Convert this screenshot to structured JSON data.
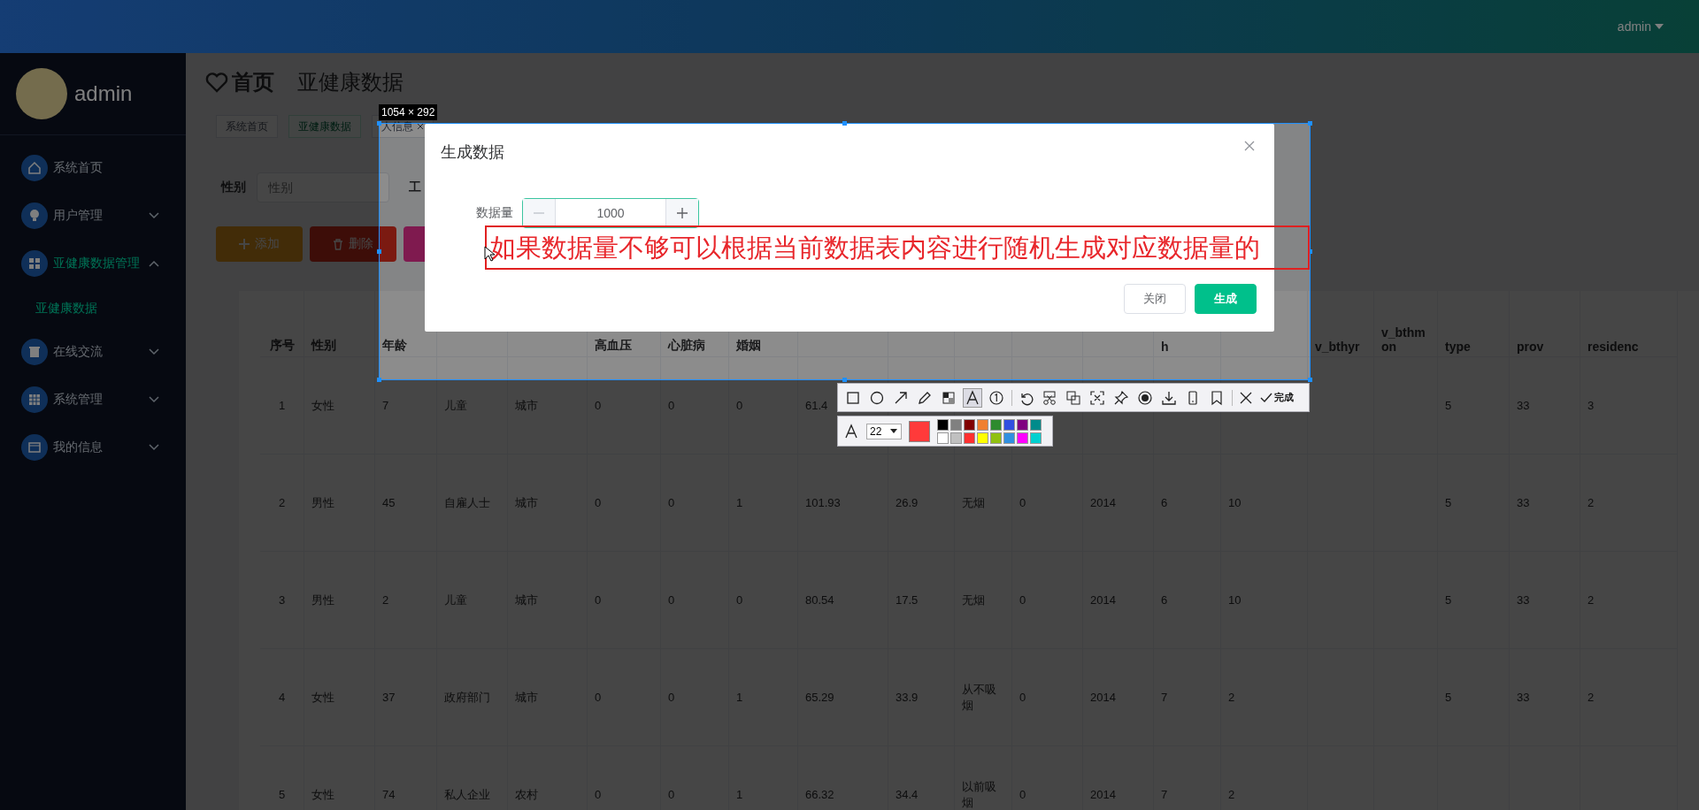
{
  "header": {
    "user": "admin"
  },
  "sidebar": {
    "profile_name": "admin",
    "items": [
      {
        "label": "系统首页",
        "kind": "link",
        "selected": false
      },
      {
        "label": "用户管理",
        "kind": "group",
        "selected": false,
        "expanded": false
      },
      {
        "label": "亚健康数据管理",
        "kind": "group",
        "selected": true,
        "expanded": true,
        "children": [
          {
            "label": "亚健康数据",
            "selected": true
          }
        ]
      },
      {
        "label": "在线交流",
        "kind": "group",
        "selected": false,
        "expanded": false
      },
      {
        "label": "系统管理",
        "kind": "group",
        "selected": false,
        "expanded": false
      },
      {
        "label": "我的信息",
        "kind": "group",
        "selected": false,
        "expanded": false
      }
    ]
  },
  "page_title": {
    "home": "首页",
    "current": "亚健康数据"
  },
  "tags": [
    {
      "label": "系统首页",
      "selected": false,
      "closable": false
    },
    {
      "label": "亚健康数据",
      "selected": true,
      "closable": false
    },
    {
      "label": "人信息",
      "selected": false,
      "closable": true
    }
  ],
  "filters": [
    {
      "label": "性别",
      "placeholder": "性别"
    },
    {
      "label": "工"
    }
  ],
  "actions": [
    {
      "label": "添加",
      "kind": "add"
    },
    {
      "label": "删除",
      "kind": "delete"
    },
    {
      "kind": "plain"
    }
  ],
  "table": {
    "columns": [
      "序号",
      "性别",
      "年龄",
      null,
      null,
      "高血压",
      "心脏病",
      "婚姻",
      null,
      null,
      null,
      null,
      null,
      "h",
      null,
      "v_bthyr",
      "v_bthmon",
      "type",
      "prov",
      "residenc"
    ],
    "rows": [
      [
        "1",
        "女性",
        "7",
        "儿童",
        "城市",
        "0",
        "0",
        "0",
        "61.4",
        null,
        null,
        null,
        null,
        null,
        null,
        null,
        null,
        "5",
        "33",
        "3"
      ],
      [
        "2",
        "男性",
        "45",
        "自雇人士",
        "城市",
        "0",
        "0",
        "1",
        "101.93",
        "26.9",
        "无烟",
        "0",
        "2014",
        "6",
        "10",
        null,
        null,
        "5",
        "33",
        "2"
      ],
      [
        "3",
        "男性",
        "2",
        "儿童",
        "城市",
        "0",
        "0",
        "0",
        "80.54",
        "17.5",
        "无烟",
        "0",
        "2014",
        "6",
        "10",
        null,
        null,
        "5",
        "33",
        "2"
      ],
      [
        "4",
        "女性",
        "37",
        "政府部门",
        "城市",
        "0",
        "0",
        "1",
        "65.29",
        "33.9",
        "从不吸烟",
        "0",
        "2014",
        "7",
        "2",
        null,
        null,
        "5",
        "33",
        "2"
      ],
      [
        "5",
        "女性",
        "74",
        "私人企业",
        "农村",
        "0",
        "0",
        "1",
        "66.32",
        "34.4",
        "以前吸烟",
        "0",
        "2014",
        "7",
        "2",
        null,
        null,
        null,
        null,
        null
      ]
    ]
  },
  "dialog": {
    "title": "生成数据",
    "field": {
      "label": "数据量",
      "value": "1000"
    },
    "buttons": [
      {
        "label": "关闭",
        "kind": "secondary"
      },
      {
        "label": "生成",
        "kind": "primary"
      }
    ]
  },
  "capture": {
    "size_label": "1054 × 292",
    "annotation": "如果数据量不够可以根据当前数据表内容进行随机生成对应数据量的",
    "tool_groups": [
      [
        {
          "kind": "rect",
          "selected": false
        },
        {
          "kind": "ellipse",
          "selected": false
        },
        {
          "kind": "arrow",
          "selected": false
        },
        {
          "kind": "pen",
          "selected": false
        },
        {
          "kind": "mosaic",
          "selected": false
        },
        {
          "kind": "text",
          "selected": true
        },
        {
          "kind": "number",
          "selected": false
        }
      ],
      [
        {
          "kind": "undo",
          "selected": false
        },
        {
          "kind": "cut",
          "selected": false
        },
        {
          "kind": "copy",
          "selected": false
        },
        {
          "kind": "scan",
          "selected": false
        },
        {
          "kind": "pin",
          "selected": false
        },
        {
          "kind": "record",
          "selected": false
        },
        {
          "kind": "download",
          "selected": false
        },
        {
          "kind": "phone",
          "selected": false
        },
        {
          "kind": "bookmark",
          "selected": false
        }
      ],
      [
        {
          "kind": "close",
          "selected": false
        }
      ]
    ],
    "done_label": "完成",
    "font_size": "22",
    "current_swatch": {
      "color": "#ff3a3a"
    },
    "palette": [
      {
        "color": "#000000"
      },
      {
        "color": "#808080"
      },
      {
        "color": "#800000"
      },
      {
        "color": "#f08030"
      },
      {
        "color": "#2e8b2e"
      },
      {
        "color": "#3050e0"
      },
      {
        "color": "#800080"
      },
      {
        "color": "#008b8b"
      },
      {
        "color": "#ffffff"
      },
      {
        "color": "#c0c0c0"
      },
      {
        "color": "#ff3030"
      },
      {
        "color": "#ffff00"
      },
      {
        "color": "#90c010"
      },
      {
        "color": "#3090e0"
      },
      {
        "color": "#ff00ff"
      },
      {
        "color": "#00d0d0"
      }
    ]
  }
}
